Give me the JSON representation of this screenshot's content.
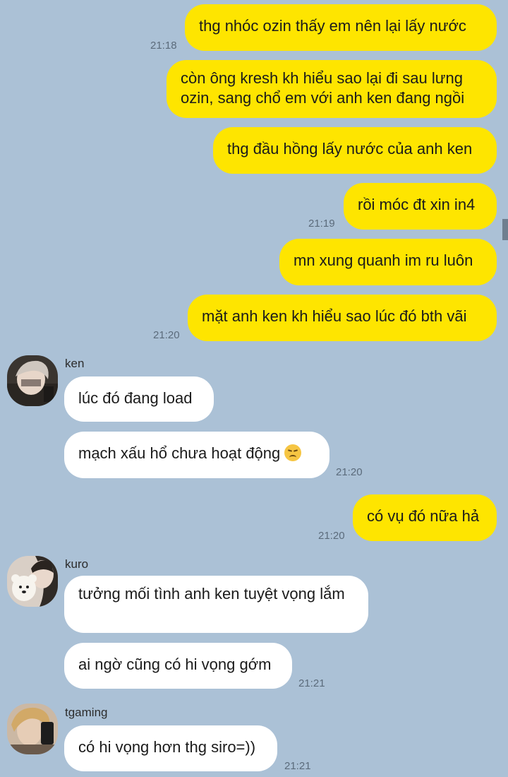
{
  "chat": {
    "messages": {
      "m1": {
        "text": "thg nhóc ozin thấy em nên lại lấy nước",
        "time": "21:18"
      },
      "m2": {
        "text": "còn ông kresh kh hiểu sao lại đi sau lưng ozin, sang chổ em với anh ken đang ngồi"
      },
      "m3": {
        "text": "thg đầu hồng lấy nước của anh ken"
      },
      "m4": {
        "text": "rồi móc đt xin in4",
        "time": "21:19"
      },
      "m5": {
        "text": "mn xung quanh im ru luôn"
      },
      "m6": {
        "text": "mặt anh ken kh hiểu sao lúc đó bth vãi",
        "time": "21:20"
      },
      "m7": {
        "sender": "ken",
        "text": "lúc đó đang load"
      },
      "m8": {
        "text": "mạch xấu hổ chưa hoạt động",
        "emoji": "disappointed-face",
        "time": "21:20"
      },
      "m9": {
        "text": "có vụ đó nữa hả",
        "time": "21:20"
      },
      "m10": {
        "sender": "kuro",
        "text": "tưởng mối tình anh ken tuyệt vọng lắm"
      },
      "m11": {
        "text": "ai ngờ cũng có hi vọng gớm",
        "time": "21:21"
      },
      "m12": {
        "sender": "tgaming",
        "text": "có hi vọng hơn thg siro=))",
        "time": "21:21"
      }
    }
  },
  "colors": {
    "background": "#abc1d6",
    "my_bubble": "#fee500",
    "their_bubble": "#ffffff",
    "timestamp": "#5b6b7b"
  }
}
